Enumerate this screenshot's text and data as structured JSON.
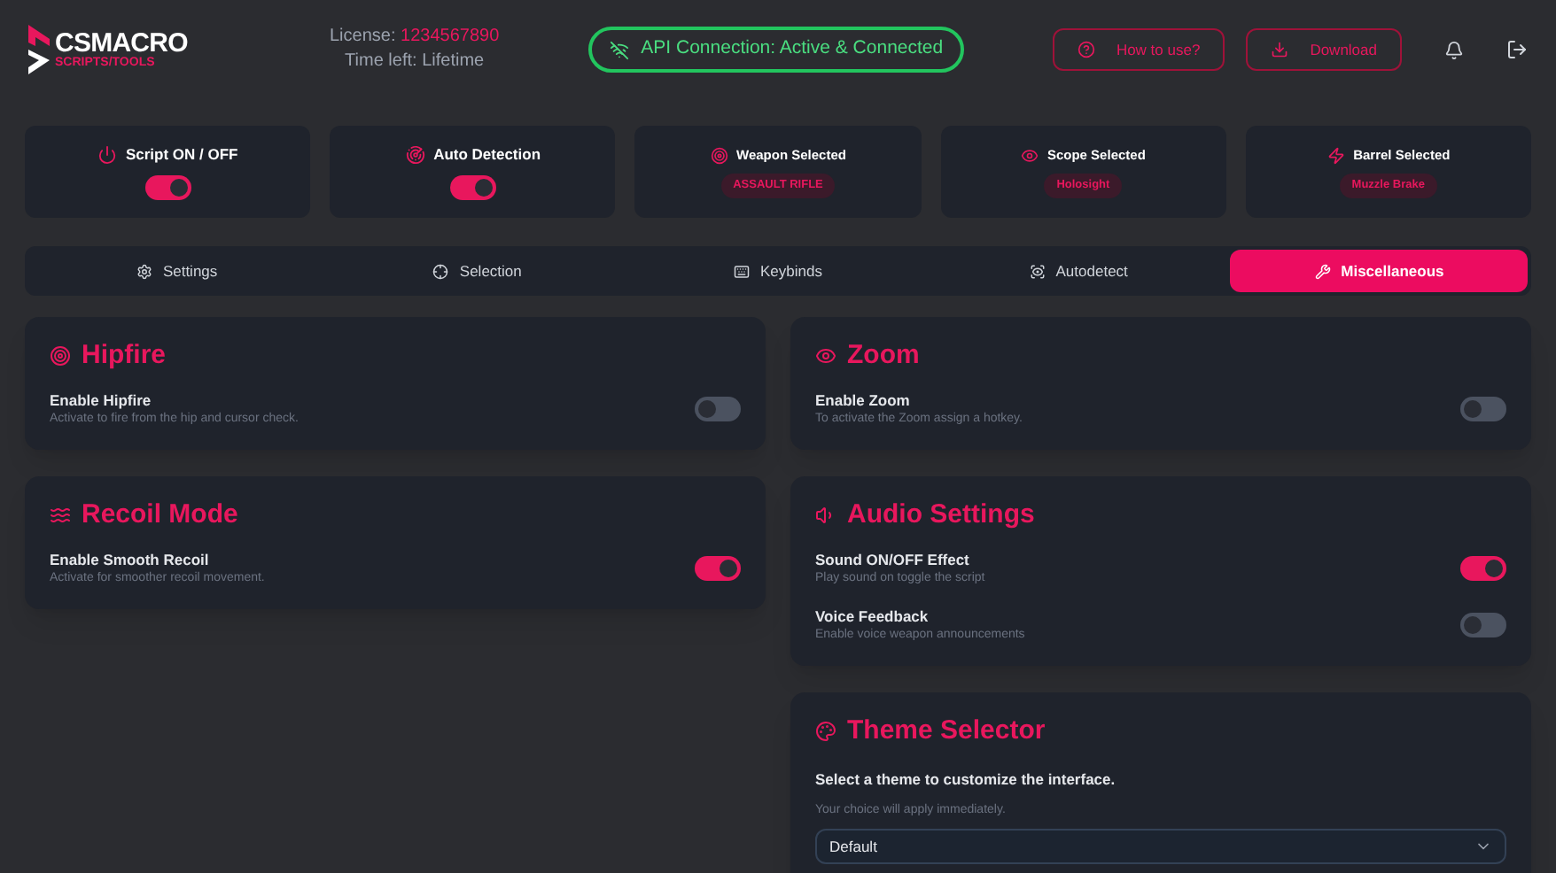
{
  "header": {
    "logo": {
      "title": "CSMACRO",
      "subtitle": "SCRIPTS/TOOLS"
    },
    "license": {
      "label": "License:",
      "value": "1234567890"
    },
    "time_left": "Time left: Lifetime",
    "api_status": {
      "text": "API Connection: Active & Connected"
    },
    "buttons": [
      "How to use?",
      "Download"
    ]
  },
  "status_cards": [
    {
      "kind": "toggle",
      "label": "Script ON / OFF",
      "on": true
    },
    {
      "kind": "toggle",
      "label": "Auto Detection",
      "on": true
    },
    {
      "kind": "badge",
      "label": "Weapon Selected",
      "value": "ASSAULT RIFLE"
    },
    {
      "kind": "badge",
      "label": "Scope Selected",
      "value": "Holosight"
    },
    {
      "kind": "badge",
      "label": "Barrel Selected",
      "value": "Muzzle Brake"
    }
  ],
  "tabs": [
    {
      "label": "Settings",
      "selected": false
    },
    {
      "label": "Selection",
      "selected": false
    },
    {
      "label": "Keybinds",
      "selected": false
    },
    {
      "label": "Autodetect",
      "selected": false
    },
    {
      "label": "Miscellaneous",
      "selected": true
    }
  ],
  "columns": [
    {
      "sections": [
        {
          "kind": "toggles",
          "title": "Hipfire",
          "settings": [
            {
              "label": "Enable Hipfire",
              "description": "Activate to fire from the hip and cursor check.",
              "on": false
            }
          ]
        },
        {
          "kind": "toggles",
          "title": "Recoil Mode",
          "settings": [
            {
              "label": "Enable Smooth Recoil",
              "description": "Activate for smoother recoil movement.",
              "on": true
            }
          ]
        }
      ]
    },
    {
      "sections": [
        {
          "kind": "toggles",
          "title": "Zoom",
          "settings": [
            {
              "label": "Enable Zoom",
              "description": "To activate the Zoom assign a hotkey.",
              "on": false
            }
          ]
        },
        {
          "kind": "toggles",
          "title": "Audio Settings",
          "settings": [
            {
              "label": "Sound ON/OFF Effect",
              "description": "Play sound on toggle the script",
              "on": true
            },
            {
              "label": "Voice Feedback",
              "description": "Enable voice weapon announcements",
              "on": false
            }
          ]
        },
        {
          "kind": "theme",
          "title": "Theme Selector",
          "description": "Select a theme to customize the interface.",
          "note": "Your choice will apply immediately.",
          "value": "Default"
        }
      ]
    }
  ]
}
